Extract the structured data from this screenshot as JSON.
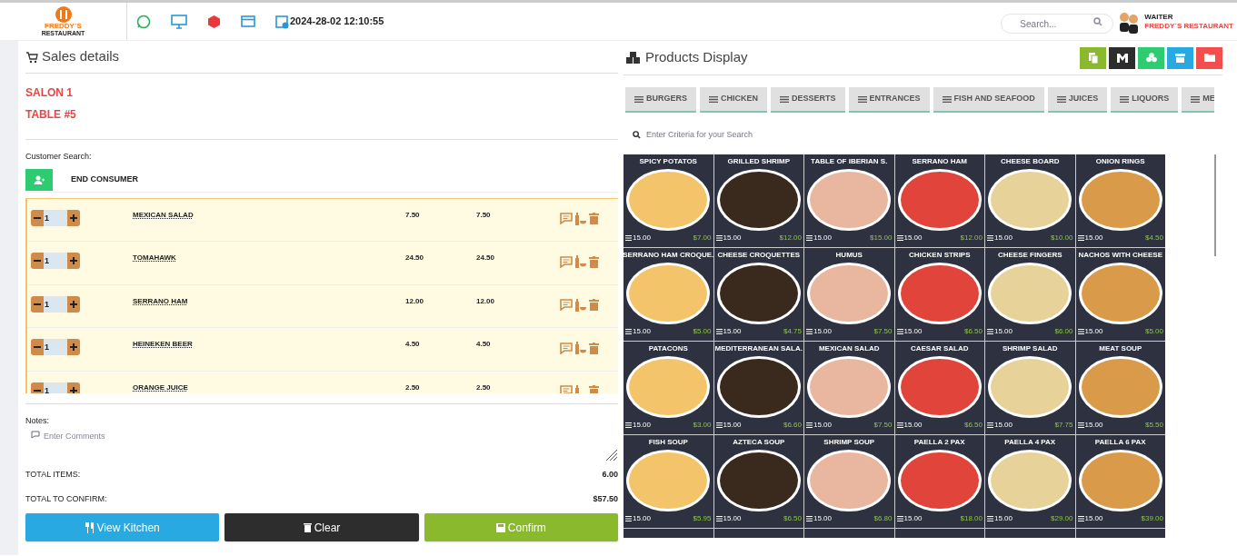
{
  "header": {
    "logo": {
      "line_1": "FREDDY´S",
      "line_2": "RESTAURANT"
    },
    "datetime": "2024-28-02 12:10:55",
    "search": {
      "placeholder": "Search..."
    },
    "user": {
      "role": "WAITER",
      "company": "FREDDY´S RESTAURANT"
    }
  },
  "sales": {
    "title": "Sales details",
    "salon": "SALON 1",
    "table": "TABLE #5",
    "customer_label": "Customer Search:",
    "customer": "END CONSUMER",
    "items": [
      {
        "qty": "1",
        "name": "MEXICAN SALAD",
        "price": "7.50",
        "total": "7.50"
      },
      {
        "qty": "1",
        "name": "TOMAHAWK",
        "price": "24.50",
        "total": "24.50"
      },
      {
        "qty": "1",
        "name": "SERRANO HAM",
        "price": "12.00",
        "total": "12.00"
      },
      {
        "qty": "1",
        "name": "HEINEKEN BEER",
        "price": "4.50",
        "total": "4.50"
      },
      {
        "qty": "1",
        "name": "ORANGE JUICE",
        "price": "2.50",
        "total": "2.50"
      }
    ],
    "notes_label": "Notes:",
    "notes_placeholder": "Enter Comments",
    "total_items_label": "TOTAL ITEMS:",
    "total_items": "6.00",
    "total_confirm_label": "TOTAL TO CONFIRM:",
    "total_confirm": "$57.50",
    "buttons": [
      {
        "kind": "kitchen",
        "label": "View Kitchen"
      },
      {
        "kind": "clear",
        "label": "Clear"
      },
      {
        "kind": "confirm",
        "label": "Confirm"
      }
    ]
  },
  "products": {
    "title": "Products Display",
    "tabs": [
      {
        "label": "BURGERS",
        "selected": false
      },
      {
        "label": "CHICKEN",
        "selected": false
      },
      {
        "label": "DESSERTS",
        "selected": false
      },
      {
        "label": "ENTRANCES",
        "selected": false
      },
      {
        "label": "FISH AND SEAFOOD",
        "selected": false
      },
      {
        "label": "JUICES",
        "selected": false
      },
      {
        "label": "LIQUORS",
        "selected": false
      },
      {
        "label": "ME",
        "selected": false
      }
    ],
    "search_placeholder": "Enter Criteria for your Search",
    "items": [
      {
        "name": "SPICY POTATOS",
        "stock": "15.00",
        "price": "$7.00"
      },
      {
        "name": "GRILLED SHRIMP",
        "stock": "15.00",
        "price": "$12.00"
      },
      {
        "name": "TABLE OF IBERIAN S.",
        "stock": "15.00",
        "price": "$15.00"
      },
      {
        "name": "SERRANO HAM",
        "stock": "15.00",
        "price": "$12.00"
      },
      {
        "name": "CHEESE BOARD",
        "stock": "15.00",
        "price": "$10.00"
      },
      {
        "name": "ONION RINGS",
        "stock": "15.00",
        "price": "$4.50"
      },
      {
        "name": "SERRANO HAM CROQUE.",
        "stock": "15.00",
        "price": "$5.00"
      },
      {
        "name": "CHEESE CROQUETTES",
        "stock": "15.00",
        "price": "$4.75"
      },
      {
        "name": "HUMUS",
        "stock": "15.00",
        "price": "$7.50"
      },
      {
        "name": "CHICKEN STRIPS",
        "stock": "15.00",
        "price": "$6.50"
      },
      {
        "name": "CHEESE FINGERS",
        "stock": "15.00",
        "price": "$6.00"
      },
      {
        "name": "NACHOS WITH CHEESE",
        "stock": "15.00",
        "price": "$5.00"
      },
      {
        "name": "PATACONS",
        "stock": "15.00",
        "price": "$3.00"
      },
      {
        "name": "MEDITERRANEAN SALA.",
        "stock": "15.00",
        "price": "$6.60"
      },
      {
        "name": "MEXICAN SALAD",
        "stock": "15.00",
        "price": "$7.50"
      },
      {
        "name": "CAESAR SALAD",
        "stock": "15.00",
        "price": "$6.50"
      },
      {
        "name": "SHRIMP SALAD",
        "stock": "15.00",
        "price": "$7.75"
      },
      {
        "name": "MEAT SOUP",
        "stock": "15.00",
        "price": "$5.50"
      },
      {
        "name": "FISH SOUP",
        "stock": "15.00",
        "price": "$5.95"
      },
      {
        "name": "AZTECA SOUP",
        "stock": "15.00",
        "price": "$6.50"
      },
      {
        "name": "SHRIMP SOUP",
        "stock": "15.00",
        "price": "$6.80"
      },
      {
        "name": "PAELLA 2 PAX",
        "stock": "15.00",
        "price": "$18.00"
      },
      {
        "name": "PAELLA 4 PAX",
        "stock": "15.00",
        "price": "$29.00"
      },
      {
        "name": "PAELLA 6 PAX",
        "stock": "15.00",
        "price": "$39.00"
      }
    ]
  }
}
